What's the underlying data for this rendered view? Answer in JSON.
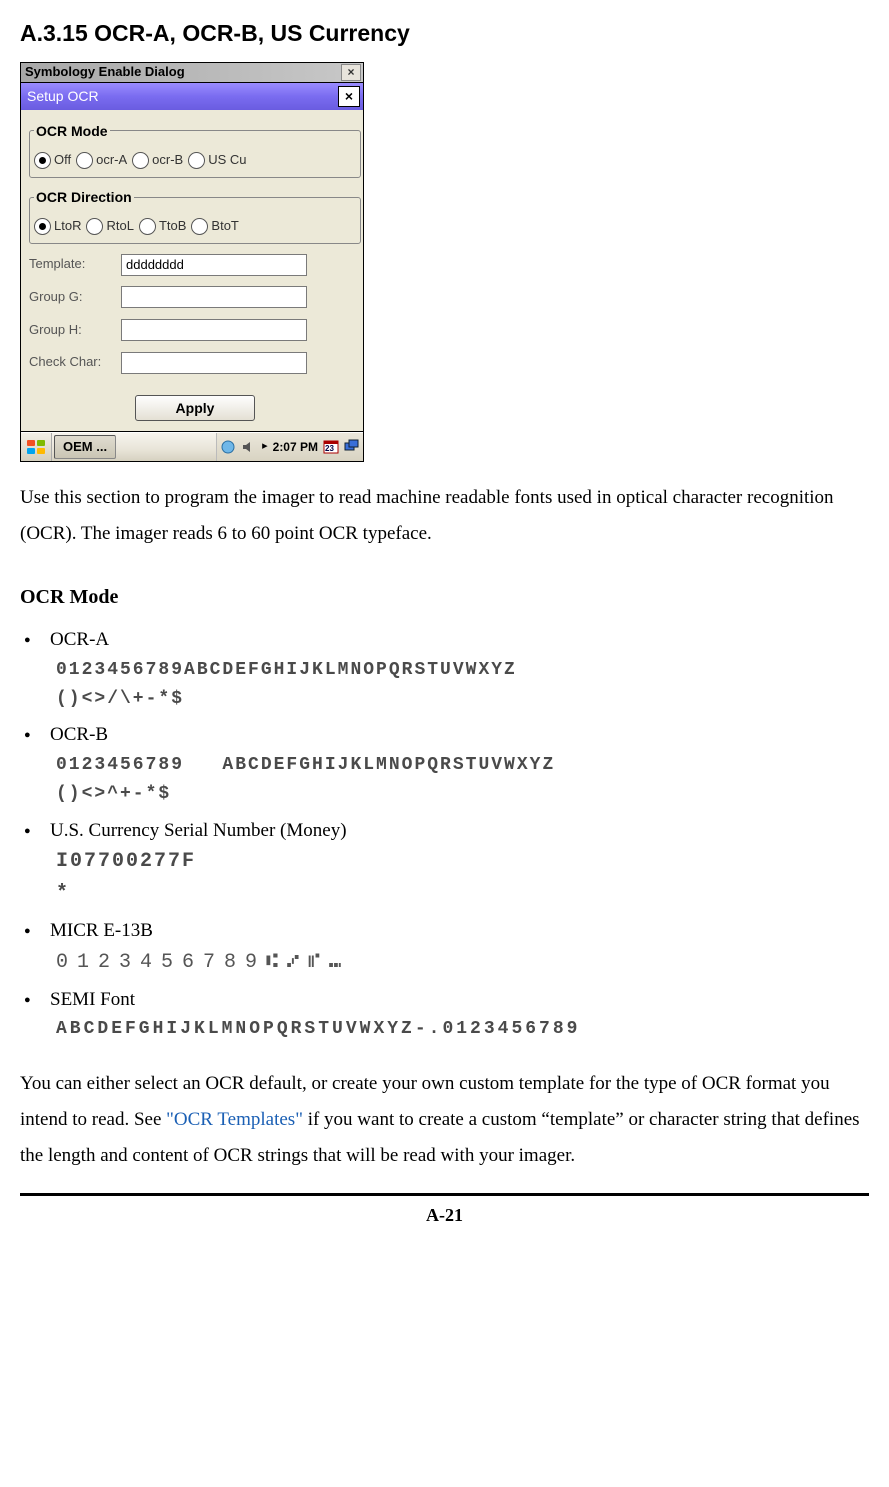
{
  "heading": "A.3.15 OCR-A, OCR-B, US Currency",
  "dialog": {
    "bg_title": "Symbology Enable Dialog",
    "title": "Setup OCR",
    "close_x": "×",
    "groups": {
      "mode": {
        "legend": "OCR Mode",
        "options": [
          {
            "label": "Off",
            "checked": true
          },
          {
            "label": "ocr-A",
            "checked": false
          },
          {
            "label": "ocr-B",
            "checked": false
          },
          {
            "label": "US Cu",
            "checked": false
          }
        ]
      },
      "direction": {
        "legend": "OCR Direction",
        "options": [
          {
            "label": "LtoR",
            "checked": true
          },
          {
            "label": "RtoL",
            "checked": false
          },
          {
            "label": "TtoB",
            "checked": false
          },
          {
            "label": "BtoT",
            "checked": false
          }
        ]
      }
    },
    "fields": {
      "template": {
        "label": "Template:",
        "value": "dddddddd"
      },
      "group_g": {
        "label": "Group G:",
        "value": ""
      },
      "group_h": {
        "label": "Group H:",
        "value": ""
      },
      "check_char": {
        "label": "Check Char:",
        "value": ""
      }
    },
    "apply_label": "Apply",
    "taskbar": {
      "task_label": "OEM ...",
      "clock": "2:07 PM",
      "calendar_badge": "23"
    }
  },
  "paragraph1": "Use this section to program the imager to read machine readable fonts used in optical character recognition (OCR). The imager reads 6 to 60 point OCR typeface.",
  "subheading": "OCR Mode",
  "fonts": {
    "ocra": {
      "label": "OCR-A",
      "sample_l1": "0123456789ABCDEFGHIJKLMNOPQRSTUVWXYZ",
      "sample_l2": "()<>/\\+-*$"
    },
    "ocrb": {
      "label": "OCR-B",
      "sample_l1": "0123456789   ABCDEFGHIJKLMNOPQRSTUVWXYZ",
      "sample_l2": "()<>^+-*$"
    },
    "money": {
      "label": "U.S. Currency Serial Number (Money)",
      "sample_l1": "I07700277F",
      "sample_l2": "*"
    },
    "micr": {
      "label": "MICR E-13B",
      "sample": "0123456789⑆⑇⑈⑉"
    },
    "semi": {
      "label": "SEMI Font",
      "sample": "ABCDEFGHIJKLMNOPQRSTUVWXYZ-.0123456789"
    }
  },
  "closing": {
    "pre": "You can either select an OCR default, or create your own custom template for the type of OCR format you intend to read. See ",
    "link": "\"OCR Templates\"",
    "post": " if you want to create a custom “template” or character string that defines the length and content of OCR strings that will be read with your imager."
  },
  "page_num": "A-21"
}
